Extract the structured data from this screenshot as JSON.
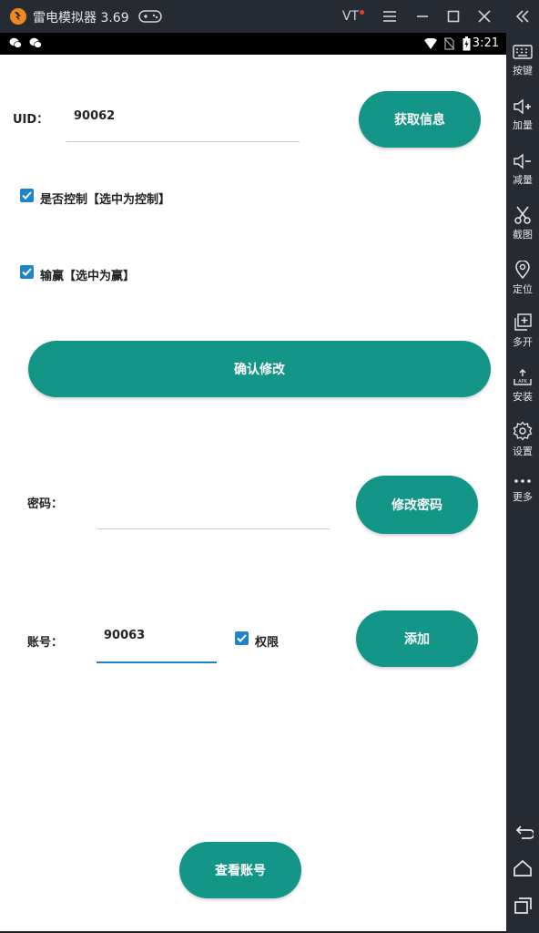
{
  "window": {
    "title": "雷电模拟器 3.69",
    "vt_label": "VT"
  },
  "statusbar": {
    "time": "3:21"
  },
  "app": {
    "uid_label": "UID：",
    "uid_value": "90062",
    "get_info_button": "获取信息",
    "checkbox_control_label": "是否控制【选中为控制】",
    "checkbox_control_checked": true,
    "checkbox_win_label": "输赢【选中为赢】",
    "checkbox_win_checked": true,
    "confirm_button": "确认修改",
    "password_label": "密码：",
    "password_value": "",
    "change_password_button": "修改密码",
    "account_label": "账号：",
    "account_value": "90063",
    "permission_label": "权限",
    "permission_checked": true,
    "add_button": "添加",
    "view_accounts_button": "查看账号",
    "accent_color": "#139688"
  },
  "sidebar": {
    "items": [
      {
        "label": "按键",
        "icon": "keyboard-icon"
      },
      {
        "label": "加量",
        "icon": "volume-up-icon"
      },
      {
        "label": "减量",
        "icon": "volume-down-icon"
      },
      {
        "label": "截图",
        "icon": "scissors-icon"
      },
      {
        "label": "定位",
        "icon": "location-icon"
      },
      {
        "label": "多开",
        "icon": "multi-open-icon"
      },
      {
        "label": "安装",
        "icon": "apk-install-icon"
      },
      {
        "label": "设置",
        "icon": "gear-icon"
      },
      {
        "label": "更多",
        "icon": "more-icon"
      }
    ]
  }
}
